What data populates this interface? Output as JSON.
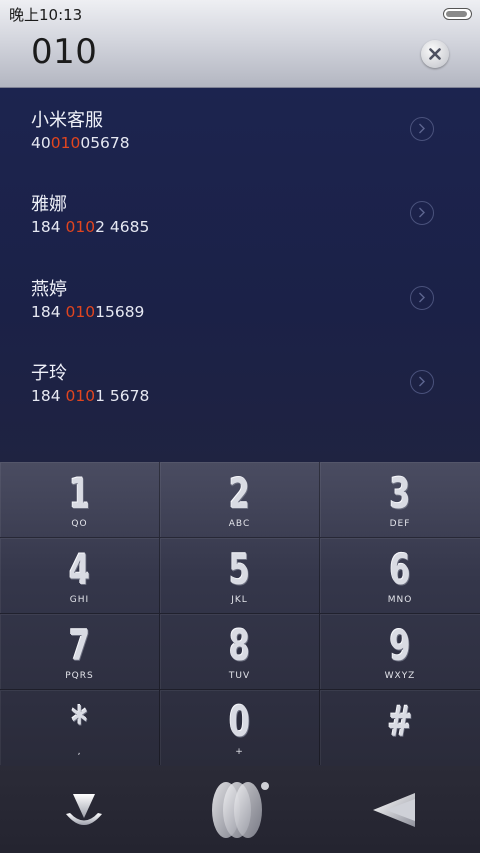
{
  "status_bar": {
    "time": "晚上10:13"
  },
  "dialer": {
    "number": "010"
  },
  "results": [
    {
      "name": "小米客服",
      "num_before": "40",
      "num_match": "010",
      "num_after": "05678"
    },
    {
      "name": "雅娜",
      "num_before": "184 ",
      "num_match": "010",
      "num_after": "2 4685"
    },
    {
      "name": "燕婷",
      "num_before": "184 ",
      "num_match": "010",
      "num_after": "15689"
    },
    {
      "name": "子玲",
      "num_before": "184 ",
      "num_match": "010",
      "num_after": "1 5678"
    }
  ],
  "keypad": [
    {
      "digit": "1",
      "letters": "QO"
    },
    {
      "digit": "2",
      "letters": "ABC"
    },
    {
      "digit": "3",
      "letters": "DEF"
    },
    {
      "digit": "4",
      "letters": "GHI"
    },
    {
      "digit": "5",
      "letters": "JKL"
    },
    {
      "digit": "6",
      "letters": "MNO"
    },
    {
      "digit": "7",
      "letters": "PQRS"
    },
    {
      "digit": "8",
      "letters": "TUV"
    },
    {
      "digit": "9",
      "letters": "WXYZ"
    },
    {
      "digit": "*",
      "letters": ","
    },
    {
      "digit": "0",
      "letters": "+"
    },
    {
      "digit": "#",
      "letters": ""
    }
  ],
  "bottom_bar": {
    "icons": [
      "hide-keypad-icon",
      "call-icon",
      "delete-icon"
    ]
  },
  "colors": {
    "match_highlight": "#e1451f",
    "list_background": "#1c244f",
    "keypad_background": "#34364a"
  }
}
